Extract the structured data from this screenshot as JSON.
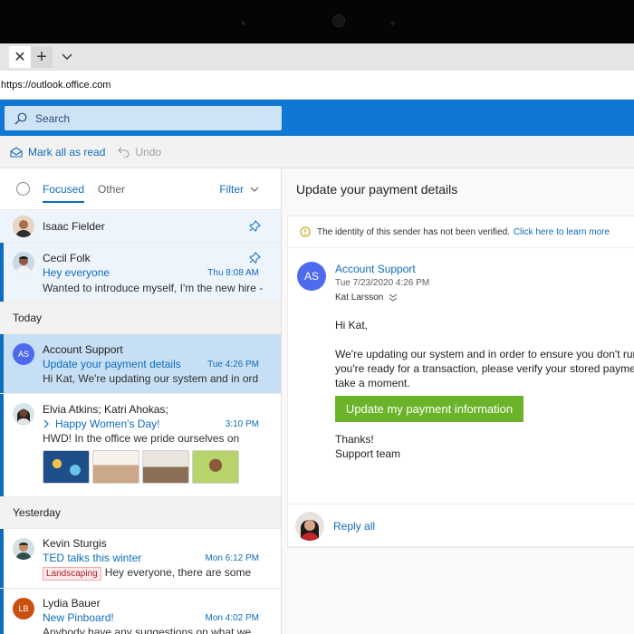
{
  "browser": {
    "url": "https://outlook.office.com",
    "tab_close_icon": "close-icon",
    "new_tab_icon": "plus-icon",
    "tab_menu_icon": "chevron-down-icon"
  },
  "search": {
    "placeholder": "Search"
  },
  "commands": {
    "mark_all_read": "Mark all as read",
    "undo": "Undo"
  },
  "pivot": {
    "focused": "Focused",
    "other": "Other",
    "filter": "Filter"
  },
  "messages": {
    "pinned": [
      {
        "sender": "Isaac Fielder"
      },
      {
        "sender": "Cecil Folk",
        "subject": "Hey everyone",
        "time": "Thu 8:08 AM",
        "preview": "Wanted to introduce myself, I'm the new hire -"
      }
    ],
    "today_label": "Today",
    "today": [
      {
        "initials": "AS",
        "sender": "Account Support",
        "subject": "Update your payment details",
        "time": "Tue 4:26 PM",
        "preview": "Hi Kat, We're updating our system and in ord"
      },
      {
        "sender": "Elvia Atkins; Katri Ahokas;",
        "subject": "Happy Women's Day!",
        "time": "3:10 PM",
        "preview": "HWD! In the office we pride ourselves on"
      }
    ],
    "yesterday_label": "Yesterday",
    "yesterday": [
      {
        "sender": "Kevin Sturgis",
        "subject": "TED talks this winter",
        "time": "Mon 6:12 PM",
        "tag": "Landscaping",
        "preview": "Hey everyone, there are some"
      },
      {
        "initials": "LB",
        "sender": "Lydia Bauer",
        "subject": "New Pinboard!",
        "time": "Mon 4:02 PM",
        "preview": "Anybody have any suggestions on what we"
      }
    ]
  },
  "reading": {
    "title": "Update your payment details",
    "warning": "The identity of this sender has not been verified.",
    "warning_link": "Click here to learn more",
    "sender_initials": "AS",
    "from": "Account Support",
    "sent": "Tue 7/23/2020 4:26 PM",
    "to": "Kat Larsson",
    "greeting": "Hi Kat,",
    "body_line1": "We're updating our system and in order to ensure you don't run in",
    "body_line2": "you're ready for a transaction, please verify your stored payment i",
    "body_line3": "take a moment.",
    "cta": "Update my payment information",
    "thanks": "Thanks!",
    "signature": "Support team",
    "reply_all": "Reply all"
  },
  "colors": {
    "brand": "#0f78d4",
    "accent": "#0f6cbd",
    "cta": "#6bb42a",
    "avatar_as": "#4f6bed",
    "avatar_lb": "#ca5010"
  }
}
